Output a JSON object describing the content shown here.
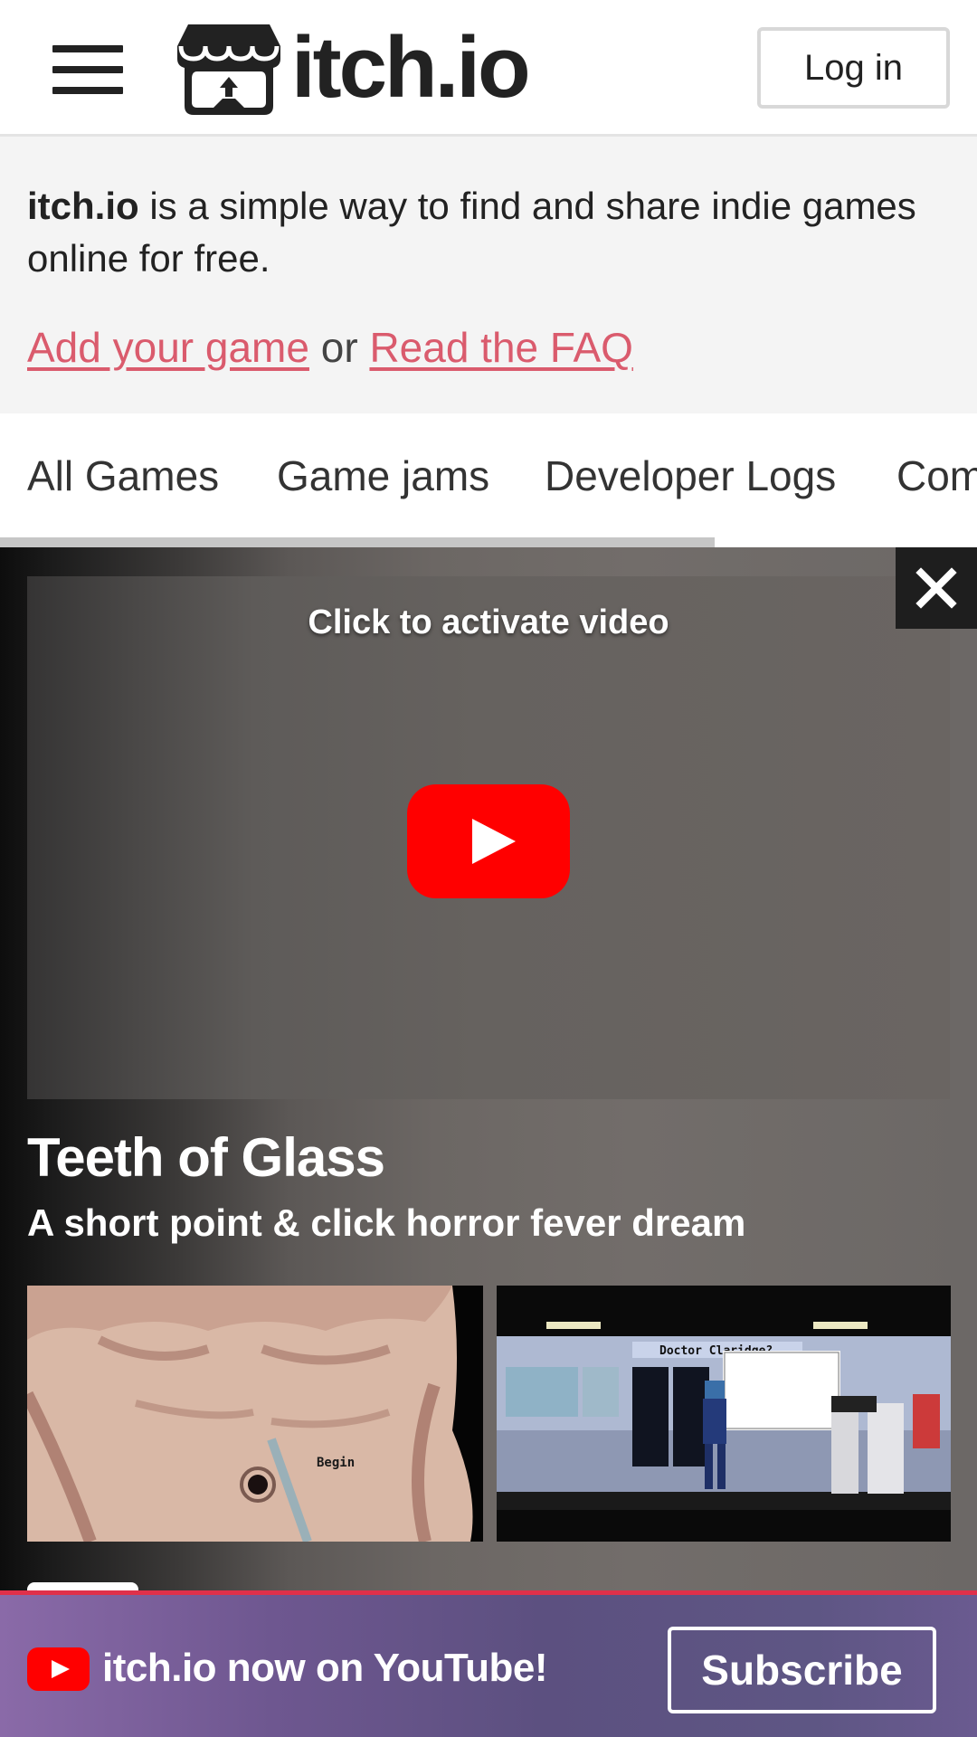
{
  "header": {
    "logo_text": "itch.io",
    "login_label": "Log in",
    "menu_icon": "hamburger-menu-icon",
    "logo_icon": "itchio-store-icon"
  },
  "intro": {
    "brand": "itch.io",
    "description": " is a simple way to find and share indie games online for free.",
    "add_game_link": "Add your game",
    "or_text": " or ",
    "faq_link": "Read the FAQ"
  },
  "tabs": [
    {
      "label": "All Games"
    },
    {
      "label": "Game jams"
    },
    {
      "label": "Developer Logs"
    },
    {
      "label": "Com"
    }
  ],
  "featured": {
    "video_caption": "Click to activate video",
    "play_icon": "youtube-play-icon",
    "close_icon": "close-icon",
    "title": "Teeth of Glass",
    "tagline": "A short point & click horror fever dream",
    "screenshots": [
      {
        "label": "Begin"
      },
      {
        "label": "Doctor Claridge?"
      }
    ]
  },
  "youtube_banner": {
    "icon": "youtube-icon",
    "text": "itch.io now on YouTube!",
    "subscribe_label": "Subscribe"
  },
  "colors": {
    "link": "#da5b6d",
    "accent_red": "#e0304a",
    "youtube_red": "#ff0000",
    "text": "#222222"
  }
}
